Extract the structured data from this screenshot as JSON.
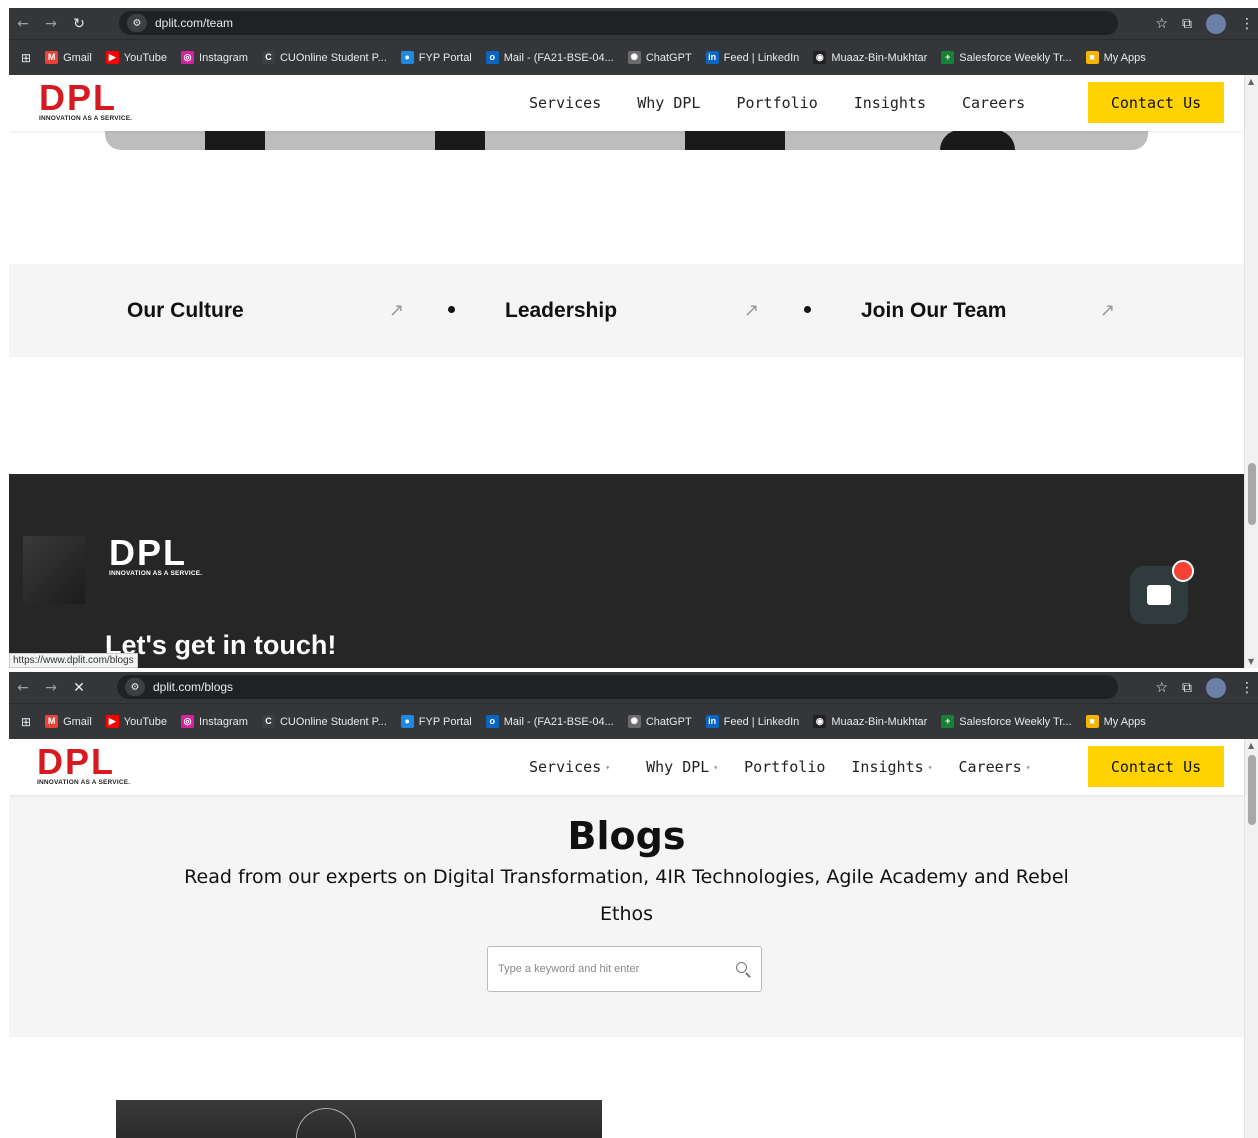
{
  "bookmarks": [
    "Gmail",
    "YouTube",
    "Instagram",
    "CUOnline Student P...",
    "FYP Portal",
    "Mail - (FA21-BSE-04...",
    "ChatGPT",
    "Feed | LinkedIn",
    "Muaaz-Bin-Mukhtar",
    "Salesforce Weekly Tr...",
    "My Apps"
  ],
  "bookmark_colors": [
    "#ea4335",
    "#ff0000",
    "#d6249f",
    "#3c4043",
    "#1e88e5",
    "#0a66c2",
    "#6b6b6b",
    "#0a66c2",
    "#222222",
    "#188038",
    "#f4b400"
  ],
  "logo": {
    "text": "DPL",
    "tagline": "INNOVATION AS A SERVICE."
  },
  "win1": {
    "url": "dplit.com/team",
    "nav": [
      "Services",
      "Why DPL",
      "Portfolio",
      "Insights",
      "Careers"
    ],
    "contact": "Contact Us",
    "band": [
      "Our Culture",
      "Leadership",
      "Join Our Team"
    ],
    "band_arrow": "↗",
    "footer_heading": "Let's get in touch!",
    "status_url": "https://www.dplit.com/blogs"
  },
  "win2": {
    "url": "dplit.com/blogs",
    "nav": [
      "Services",
      "Why DPL",
      "Portfolio",
      "Insights",
      "Careers"
    ],
    "contact": "Contact Us",
    "title": "Blogs",
    "subtitle": "Read from our experts on Digital Transformation, 4IR Technologies, Agile Academy and Rebel Ethos",
    "search_placeholder": "Type a keyword and hit enter"
  },
  "colors": {
    "brand_red": "#d71920",
    "accent_yellow": "#ffd200",
    "footer_bg": "#262626",
    "chrome_bg": "#35363a"
  }
}
